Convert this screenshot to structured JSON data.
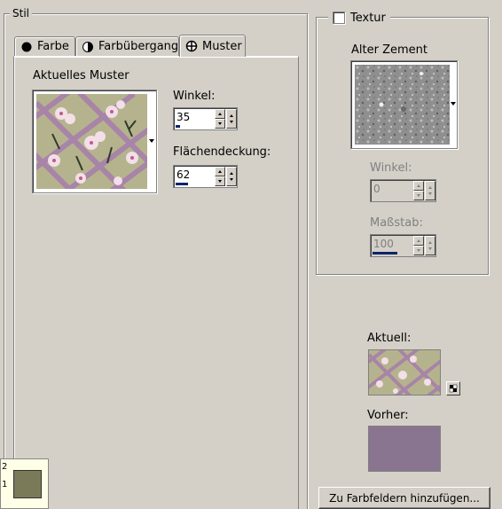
{
  "stil": {
    "legend": "Stil",
    "tabs": [
      {
        "label": "Farbe",
        "icon": "solid-color-icon",
        "active": false
      },
      {
        "label": "Farbübergang",
        "icon": "gradient-icon",
        "active": false
      },
      {
        "label": "Muster",
        "icon": "pattern-icon",
        "active": true
      }
    ],
    "current_pattern_label": "Aktuelles Muster",
    "angle_label": "Winkel:",
    "angle_value": "35",
    "angle_fraction": 0.1,
    "coverage_label": "Flächendeckung:",
    "coverage_value": "62",
    "coverage_fraction": 0.3
  },
  "texture": {
    "label": "Textur",
    "checked": false,
    "texture_name": "Alter Zement",
    "angle_label": "Winkel:",
    "angle_value": "0",
    "angle_fraction": 0.0,
    "scale_label": "Maßstab:",
    "scale_value": "100",
    "scale_fraction": 0.4
  },
  "current_label": "Aktuell:",
  "previous_label": "Vorher:",
  "add_button_label": "Zu Farbfeldern hinzufügen...",
  "corner": {
    "top_number": "2",
    "bottom_number": "1"
  },
  "colors": {
    "previous_swatch": "#8a7591",
    "corner_swatch": "#7a7a58",
    "spin_fill": "#0a246a"
  }
}
